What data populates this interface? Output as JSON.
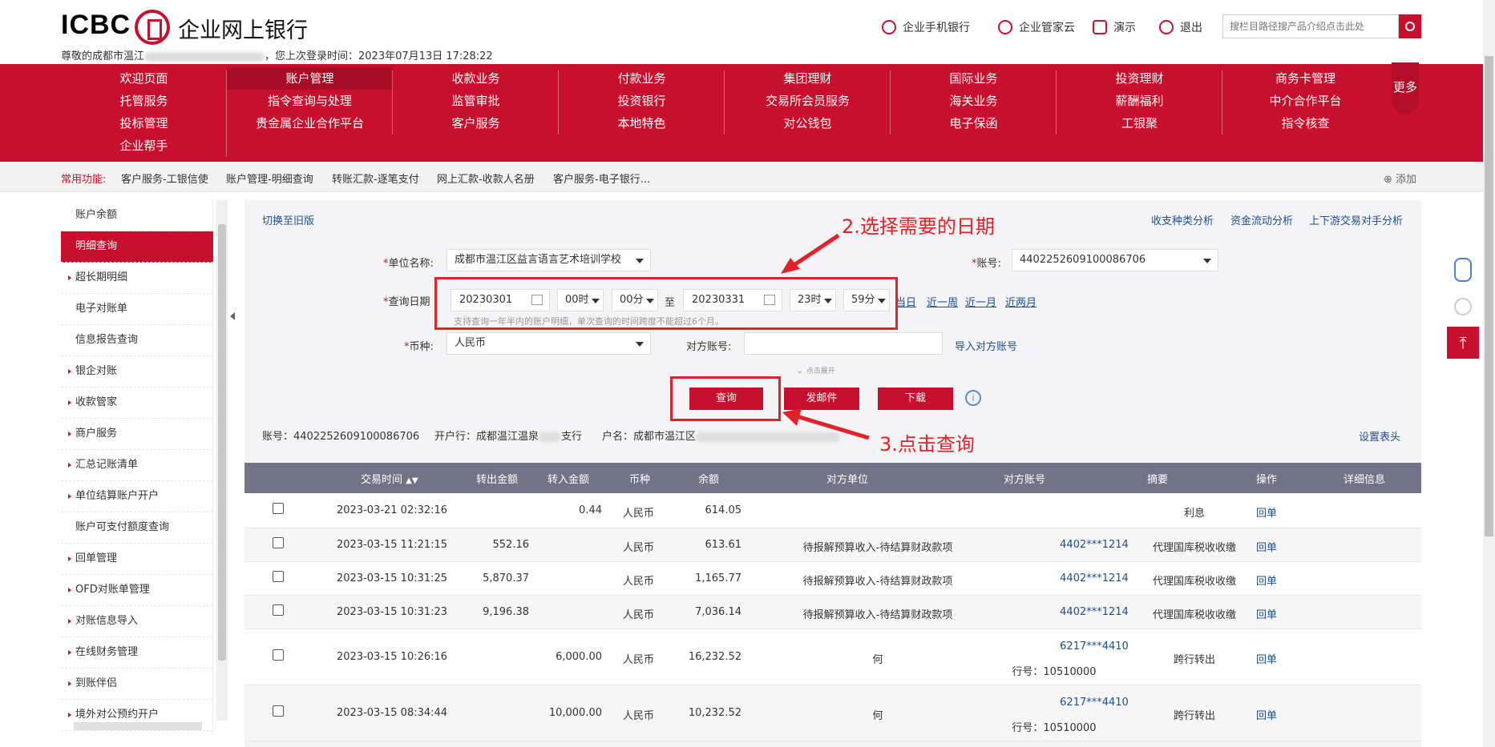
{
  "header": {
    "logo_text": "ICBC",
    "logo_cn": "企业网上银行",
    "welcome_prefix": "尊敬的成都市温江",
    "welcome_suffix": "，您上次登录时间：2023年07月13日 17:28:22",
    "links": [
      "企业手机银行",
      "企业管家云",
      "演示",
      "退出"
    ],
    "search_placeholder": "搜栏目路径搜产品介绍点击此处"
  },
  "nav": {
    "rows": [
      [
        "欢迎页面",
        "账户管理",
        "收款业务",
        "付款业务",
        "集团理财",
        "国际业务",
        "投资理财",
        "商务卡管理"
      ],
      [
        "托管服务",
        "指令查询与处理",
        "监管审批",
        "投资银行",
        "交易所会员服务",
        "海关业务",
        "薪酬福利",
        "中介合作平台"
      ],
      [
        "投标管理",
        "贵金属企业合作平台",
        "客户服务",
        "本地特色",
        "对公钱包",
        "电子保函",
        "工银聚",
        "指令核查"
      ],
      [
        "企业帮手"
      ]
    ],
    "more": "更多"
  },
  "quick": {
    "label": "常用功能:",
    "items": [
      "客户服务-工银信使",
      "账户管理-明细查询",
      "转账汇款-逐笔支付",
      "网上汇款-收款人名册",
      "客户服务-电子银行..."
    ],
    "add": "添加"
  },
  "sidebar": {
    "items": [
      "账户余额",
      "明细查询",
      "超长期明细",
      "电子对账单",
      "信息报告查询",
      "银企对账",
      "收款管家",
      "商户服务",
      "汇总记账清单",
      "单位结算账户开户",
      "账户可支付额度查询",
      "回单管理",
      "OFD对账单管理",
      "对账信息导入",
      "在线财务管理",
      "到账伴侣",
      "境外对公预约开户"
    ]
  },
  "content": {
    "switch_old": "切换至旧版",
    "analysis_links": [
      "收支种类分析",
      "资金流动分析",
      "上下游交易对手分析"
    ],
    "unit_label": "单位名称:",
    "unit_value": "成都市温江区益言语言艺术培训学校",
    "account_label": "账号:",
    "account_value": "4402252609100086706",
    "date_label": "查询日期",
    "date_start": "20230301",
    "hour_start": "00时",
    "min_start": "00分",
    "to": "至",
    "date_end": "20230331",
    "hour_end": "23时",
    "min_end": "59分",
    "quick_dates": [
      "当日",
      "近一周",
      "近一月",
      "近两月"
    ],
    "hint": "支持查询一年半内的账户明细，单次查询的时间跨度不能超过6个月。",
    "currency_label": "币种:",
    "currency_value": "人民币",
    "counter_label": "对方账号:",
    "import_counter": "导入对方账号",
    "expand": "点击展开",
    "btn_query": "查询",
    "btn_mail": "发邮件",
    "btn_download": "下载",
    "info_account": "账号：4402252609100086706",
    "info_bank": "开户行：成都温江温泉",
    "info_bank_suffix": "支行",
    "info_name": "户名：成都市温江区",
    "set_header": "设置表头"
  },
  "annotations": {
    "step2": "2.选择需要的日期",
    "step3": "3.点击查询"
  },
  "table": {
    "headers": [
      "交易时间",
      "转出金额",
      "转入金额",
      "币种",
      "余额",
      "对方单位",
      "对方账号",
      "摘要",
      "操作",
      "详细信息"
    ],
    "rows": [
      {
        "time": "2023-03-21  02:32:16",
        "out": "",
        "in": "0.44",
        "cur": "人民币",
        "bal": "614.05",
        "party": "",
        "acct": "",
        "bank": "",
        "memo": "利息",
        "op": "回单"
      },
      {
        "time": "2023-03-15  11:21:15",
        "out": "552.16",
        "in": "",
        "cur": "人民币",
        "bal": "613.61",
        "party": "待报解预算收入-待结算财政款项",
        "acct": "4402***1214",
        "bank": "",
        "memo": "代理国库税收收缴",
        "op": "回单"
      },
      {
        "time": "2023-03-15  10:31:25",
        "out": "5,870.37",
        "in": "",
        "cur": "人民币",
        "bal": "1,165.77",
        "party": "待报解预算收入-待结算财政款项",
        "acct": "4402***1214",
        "bank": "",
        "memo": "代理国库税收收缴",
        "op": "回单"
      },
      {
        "time": "2023-03-15  10:31:23",
        "out": "9,196.38",
        "in": "",
        "cur": "人民币",
        "bal": "7,036.14",
        "party": "待报解预算收入-待结算财政款项",
        "acct": "4402***1214",
        "bank": "",
        "memo": "代理国库税收收缴",
        "op": "回单"
      },
      {
        "time": "2023-03-15  10:26:16",
        "out": "",
        "in": "6,000.00",
        "cur": "人民币",
        "bal": "16,232.52",
        "party": "何",
        "acct": "6217***4410",
        "bank": "行号：10510000",
        "memo": "跨行转出",
        "op": "回单"
      },
      {
        "time": "2023-03-15  08:34:44",
        "out": "",
        "in": "10,000.00",
        "cur": "人民币",
        "bal": "10,232.52",
        "party": "何",
        "acct": "6217***4410",
        "bank": "行号：10510000",
        "memo": "跨行转出",
        "op": "回单"
      }
    ]
  }
}
